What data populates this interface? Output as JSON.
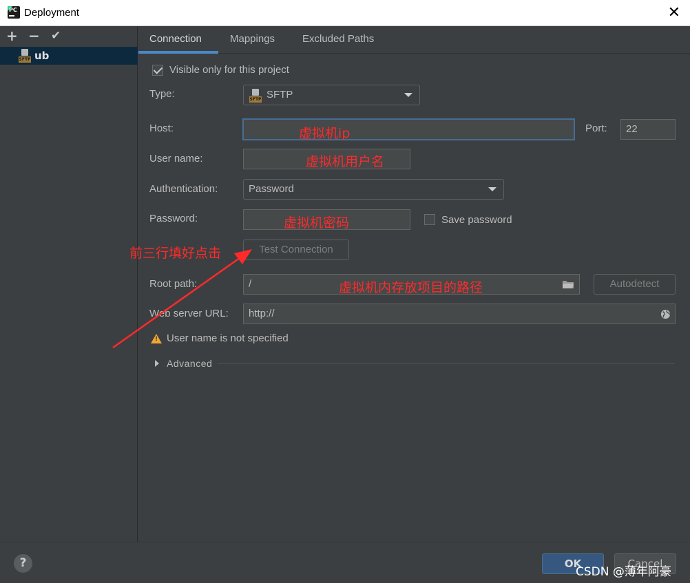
{
  "window": {
    "title": "Deployment",
    "app_icon_text": "PC",
    "close_glyph": "✕"
  },
  "left_toolbar": {
    "add": "+",
    "remove": "−",
    "apply": "✔"
  },
  "server_tree": {
    "items": [
      {
        "label": "ub",
        "icon_text": "SFTP"
      }
    ]
  },
  "tabs": [
    {
      "label": "Connection",
      "active": true
    },
    {
      "label": "Mappings"
    },
    {
      "label": "Excluded Paths"
    }
  ],
  "form": {
    "visible_only": {
      "label": "Visible only for this project",
      "checked": true
    },
    "type": {
      "label": "Type:",
      "value": "SFTP",
      "icon_text": "SFTP"
    },
    "host": {
      "label": "Host:",
      "value": ""
    },
    "port": {
      "label": "Port:",
      "value": "22"
    },
    "username": {
      "label": "User name:",
      "value": ""
    },
    "authentication": {
      "label": "Authentication:",
      "value": "Password"
    },
    "password": {
      "label": "Password:",
      "value": ""
    },
    "save_password": {
      "label": "Save password",
      "checked": false
    },
    "test_connection": {
      "label": "Test Connection"
    },
    "root_path": {
      "label": "Root path:",
      "value": "/"
    },
    "autodetect": {
      "label": "Autodetect"
    },
    "web_server_url": {
      "label": "Web server URL:",
      "value": "http://"
    },
    "warning": {
      "text": "User name is not specified"
    },
    "advanced": {
      "label": "Advanced"
    }
  },
  "annotations": {
    "host": "虚拟机ip",
    "username": "虚拟机用户名",
    "password": "虚拟机密码",
    "test_hint": "前三行填好点击",
    "root_path": "虚拟机内存放项目的路径",
    "color": "#ff2a2a"
  },
  "footer": {
    "help": "?",
    "ok": "OK",
    "cancel": "Cancel"
  },
  "watermark": "CSDN @薄年阿豪",
  "colors": {
    "accent": "#4a88c7",
    "background": "#3c3f41",
    "selected": "#0d293e",
    "warning": "#f0a732"
  }
}
